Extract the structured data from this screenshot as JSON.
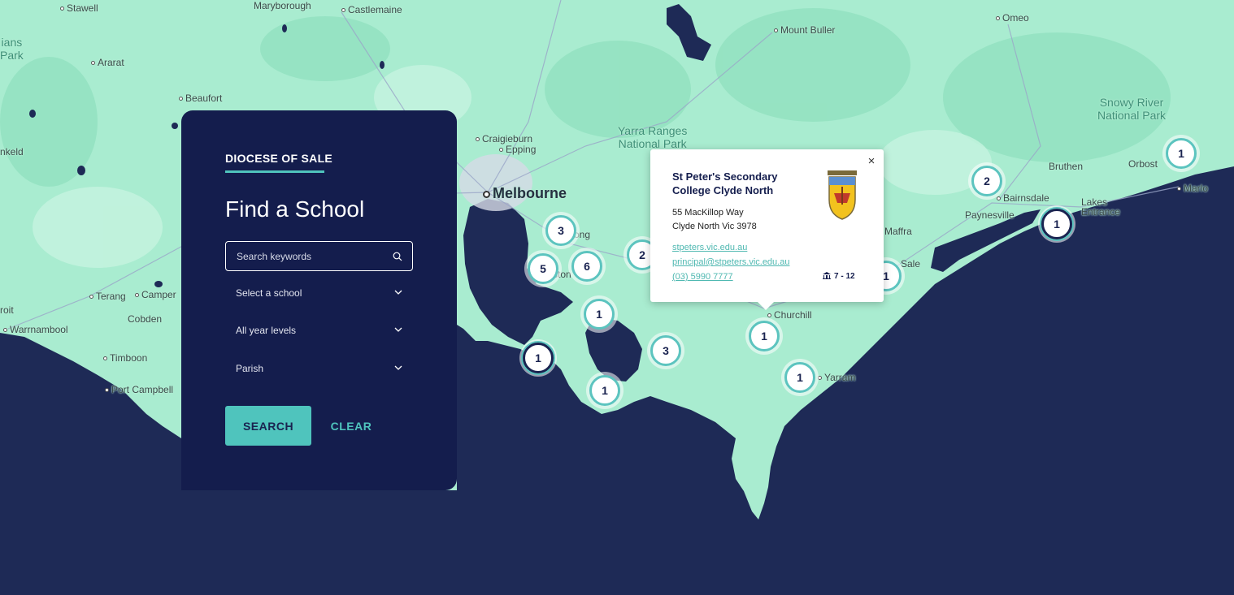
{
  "panel": {
    "org": "DIOCESE OF SALE",
    "heading": "Find a School",
    "search_placeholder": "Search keywords",
    "select_school": "Select a school",
    "year_levels": "All year levels",
    "parish": "Parish",
    "search_button": "SEARCH",
    "clear_button": "CLEAR"
  },
  "popup": {
    "title": "St Peter's Secondary College Clyde North",
    "address_line1": "55 MacKillop Way",
    "address_line2": "Clyde North Vic 3978",
    "website": "stpeters.vic.edu.au",
    "email": "principal@stpeters.vic.edu.au",
    "phone": "(03) 5990 7777",
    "year_levels": "7 - 12",
    "close_symbol": "×"
  },
  "clusters": [
    "3",
    "5",
    "6",
    "2",
    "1",
    "1",
    "3",
    "1",
    "1",
    "1",
    "1",
    "2",
    "1",
    "1"
  ],
  "places": {
    "stawell": "Stawell",
    "maryborough": "Maryborough",
    "castlemaine": "Castlemaine",
    "mount_buller": "Mount Buller",
    "omeo": "Omeo",
    "grampians_a": "ians",
    "grampians_b": "Park",
    "ararat": "Ararat",
    "beaufort": "Beaufort",
    "craigieburn": "Craigieburn",
    "epping": "Epping",
    "yarra_ranges": "Yarra Ranges",
    "national_park": "National Park",
    "melbourne": "Melbourne",
    "snowy_river": "Snowy River",
    "snowy_national_park": "National Park",
    "nkeld": "nkeld",
    "bruthen": "Bruthen",
    "orbost": "Orbost",
    "bairnsdale": "Bairnsdale",
    "marlo": "Marlo",
    "paynesville": "Paynesville",
    "lakes": "Lakes",
    "entrance": "Entrance",
    "maffra": "Maffra",
    "sale": "Sale",
    "geelong": "ong",
    "werribee": "ston",
    "terang": "Terang",
    "camperdown": "Camper",
    "broit": "roit",
    "warrnambool": "Warrnambool",
    "cobden": "Cobden",
    "timboon": "Timboon",
    "port_campbell": "Port Campbell",
    "churchill": "Churchill",
    "yarram": "Yarram"
  },
  "colors": {
    "land": "#a9ecd0",
    "sea": "#1e2a56",
    "panel": "#141d4d",
    "accent": "#4fc4bd"
  },
  "icons": [
    "search-icon",
    "chevron-down-icon",
    "close-icon",
    "school-building-icon",
    "school-crest-icon",
    "map-marker-icon"
  ]
}
